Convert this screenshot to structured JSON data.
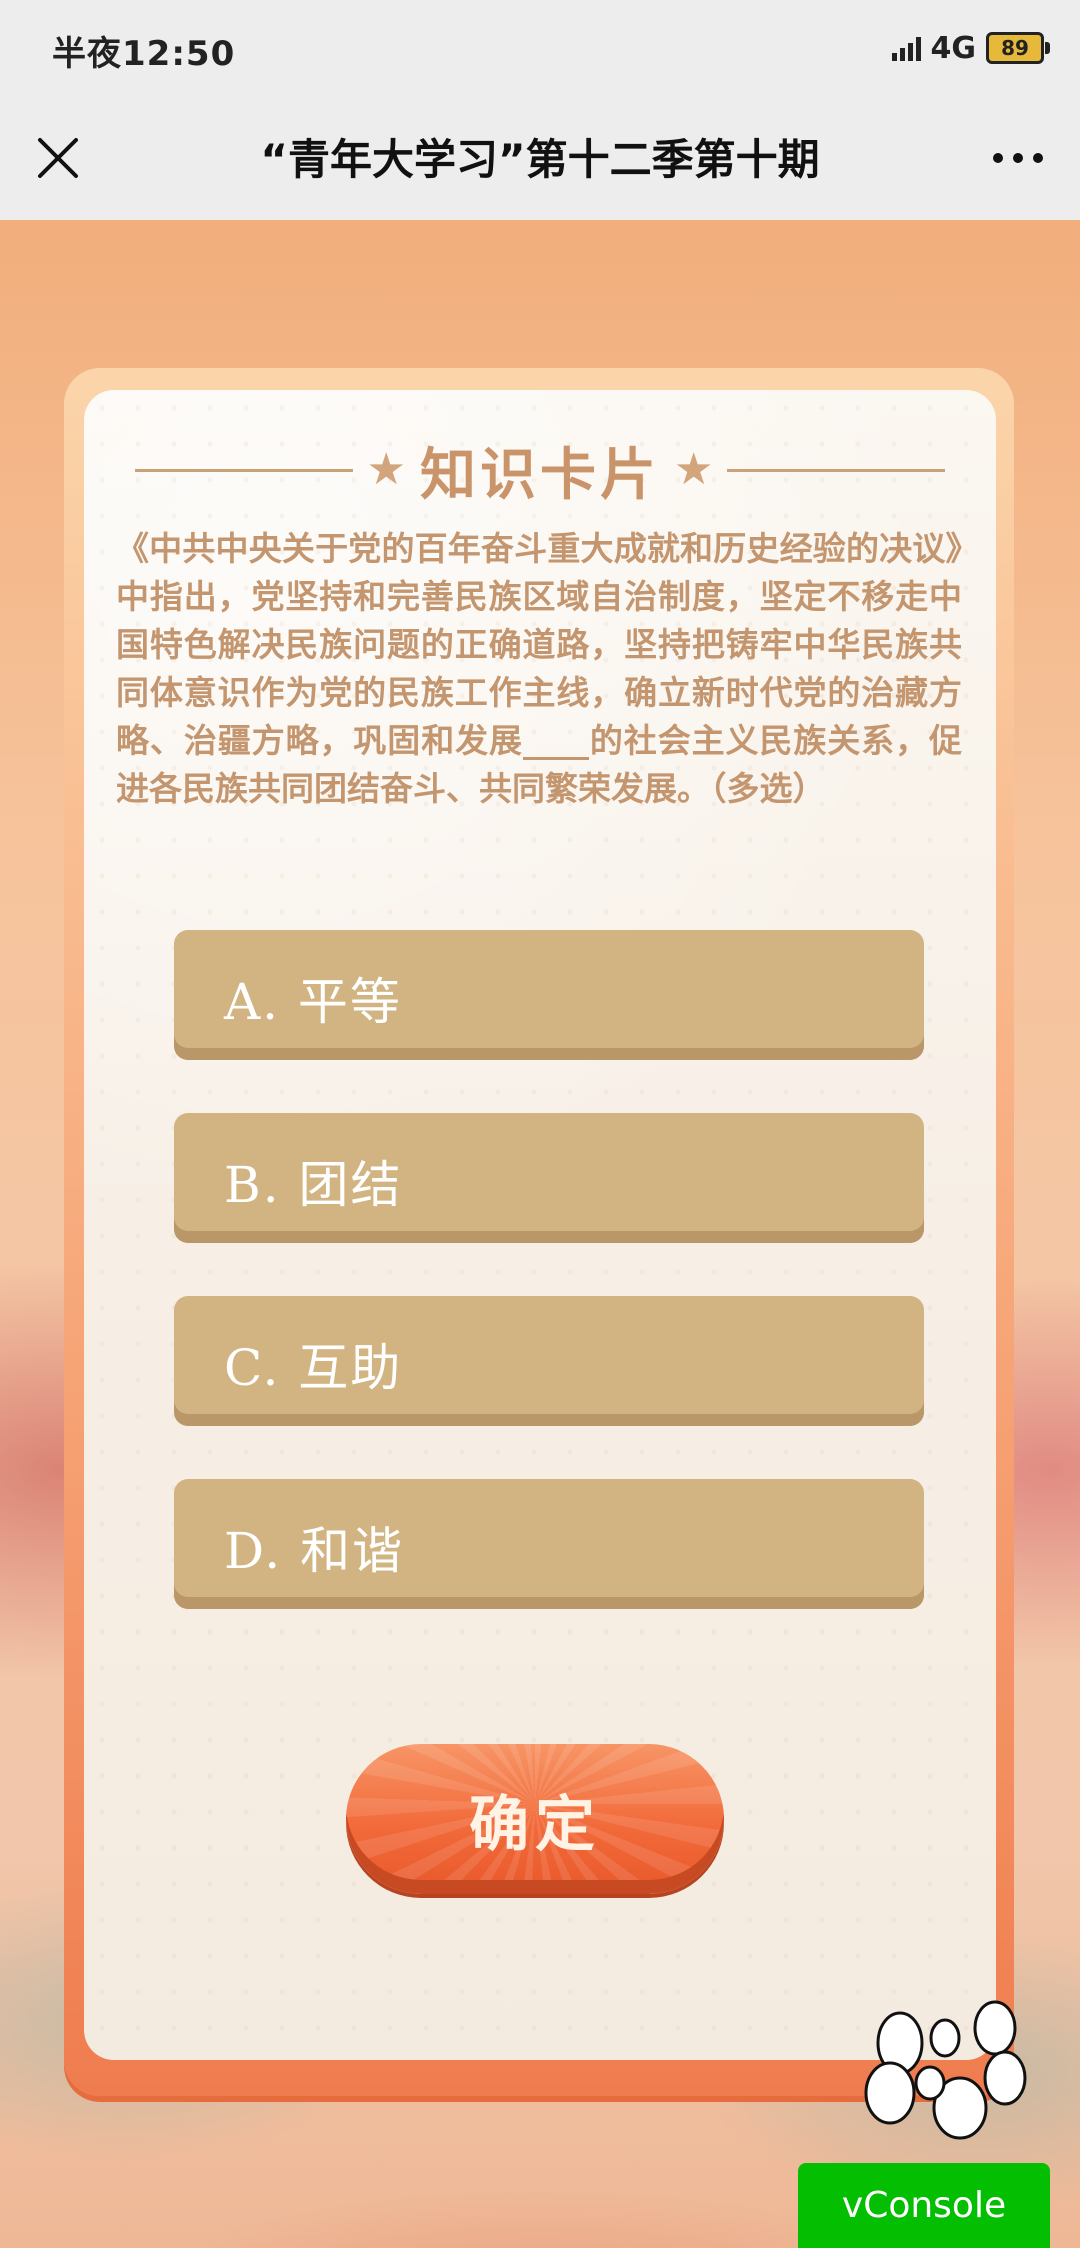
{
  "status_bar": {
    "time": "半夜12:50",
    "network": "4G",
    "battery": "89"
  },
  "header": {
    "title": "“青年大学习”第十二季第十期",
    "close_icon": "close-icon",
    "more_icon": "more-dots-icon"
  },
  "card": {
    "heading": "知识卡片",
    "question": "《中共中央关于党的百年奋斗重大成就和历史经验的决议》中指出，党坚持和完善民族区域自治制度，坚定不移走中国特色解决民族问题的正确道路，坚持把铸牢中华民族共同体意识作为党的民族工作主线，确立新时代党的治藏方略、治疆方略，巩固和发展____的社会主义民族关系，促进各民族共同团结奋斗、共同繁荣发展。（多选）",
    "options": [
      {
        "label": "A. 平等"
      },
      {
        "label": "B. 团结"
      },
      {
        "label": "C. 互助"
      },
      {
        "label": "D. 和谐"
      }
    ],
    "confirm_label": "确定"
  },
  "vconsole_label": "vConsole",
  "colors": {
    "option_bg": "#d2b483",
    "confirm_bg": "#f26a3a",
    "vconsole_bg": "#04be02"
  }
}
